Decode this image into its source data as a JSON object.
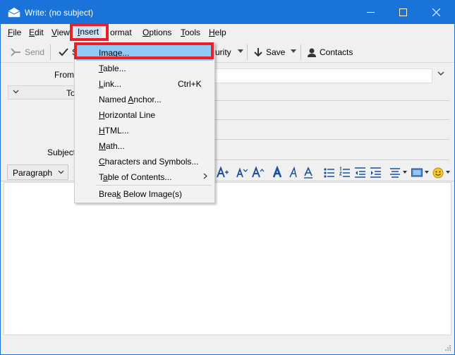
{
  "window": {
    "title": "Write: (no subject)",
    "accent": "#1a73d8"
  },
  "menubar": {
    "items": [
      {
        "label": "File",
        "mnemonic": "F",
        "rest": "ile"
      },
      {
        "label": "Edit",
        "mnemonic": "E",
        "rest": "dit"
      },
      {
        "label": "View",
        "mnemonic": "V",
        "rest": "iew"
      },
      {
        "label": "Insert",
        "mnemonic": "I",
        "rest": "nsert"
      },
      {
        "label": "Format",
        "mnemonic": "",
        "rest": "ormat"
      },
      {
        "label": "Options",
        "mnemonic": "O",
        "rest": "ptions"
      },
      {
        "label": "Tools",
        "mnemonic": "T",
        "rest": "ools"
      },
      {
        "label": "Help",
        "mnemonic": "H",
        "rest": "elp"
      }
    ]
  },
  "toolbar": {
    "send_label": "Send",
    "spell_label": "S",
    "security_label": "urity",
    "save_label": "Save",
    "contacts_label": "Contacts"
  },
  "header": {
    "from_label": "From",
    "to_label": "To",
    "subject_label": "Subject"
  },
  "format_bar": {
    "paragraph_label": "Paragraph"
  },
  "insert_menu": {
    "items": [
      {
        "label": "Image...",
        "mnemonic": "I",
        "rest": "mage...",
        "shortcut": "",
        "selected": true
      },
      {
        "label": "Table...",
        "mnemonic": "T",
        "rest": "able...",
        "shortcut": ""
      },
      {
        "label": "Link...",
        "mnemonic": "L",
        "rest": "ink...",
        "shortcut": "Ctrl+K"
      },
      {
        "label": "Named Anchor...",
        "pre": "Named ",
        "mnemonic": "A",
        "rest": "nchor...",
        "shortcut": ""
      },
      {
        "label": "Horizontal Line",
        "mnemonic": "H",
        "rest": "orizontal Line",
        "shortcut": ""
      },
      {
        "label": "HTML...",
        "mnemonic": "H",
        "rest": "TML...",
        "shortcut": ""
      },
      {
        "label": "Math...",
        "mnemonic": "M",
        "rest": "ath...",
        "shortcut": ""
      },
      {
        "label": "Characters and Symbols...",
        "mnemonic": "C",
        "rest": "haracters and Symbols...",
        "shortcut": ""
      },
      {
        "label": "Table of Contents...",
        "pre": "T",
        "mnemonic": "a",
        "rest": "ble of Contents...",
        "shortcut": "",
        "submenu": true
      },
      {
        "label": "Break Below Image(s)",
        "pre": "Brea",
        "mnemonic": "k",
        "rest": " Below Image(s)",
        "shortcut": ""
      }
    ]
  }
}
